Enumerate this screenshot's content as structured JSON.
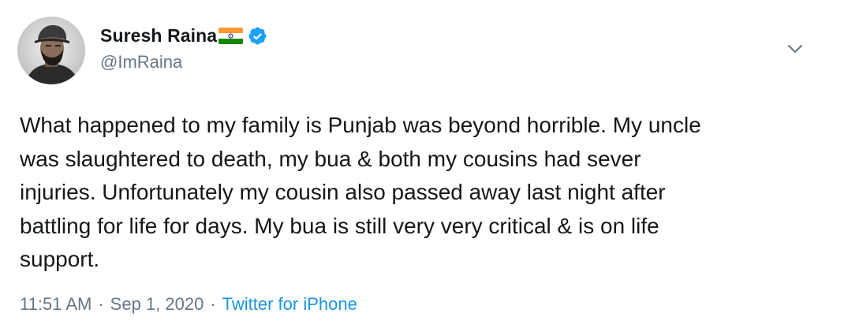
{
  "user": {
    "display_name": "Suresh Raina",
    "handle": "@ImRaina",
    "flag_icon": "india-flag-icon",
    "verified_icon": "verified-badge-icon",
    "avatar_icon": "avatar"
  },
  "tweet": {
    "text": "What happened to my family is Punjab was beyond horrible. My uncle\nwas slaughtered to death, my bua & both my cousins had sever\ninjuries. Unfortunately my cousin also passed away last night after\nbattling for life for days. My bua is still very very critical & is on life\nsupport."
  },
  "meta": {
    "time": "11:51 AM",
    "separator_1": "·",
    "date": "Sep 1, 2020",
    "separator_2": "·",
    "source": "Twitter for iPhone"
  },
  "menu": {
    "icon": "chevron-down-icon"
  },
  "colors": {
    "text_primary": "#14171a",
    "text_secondary": "#657786",
    "link": "#1b95e0",
    "verified_blue": "#1da1f2",
    "background": "#ffffff"
  }
}
